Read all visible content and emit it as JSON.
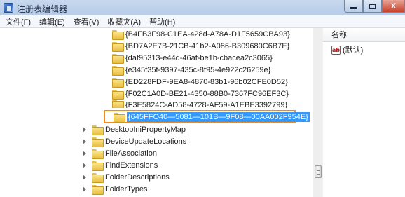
{
  "window": {
    "title": "注册表编辑器",
    "close_glyph": "X",
    "colors": {
      "titlebar": "#b7cce8",
      "selection": "#3399ff",
      "rename_border": "#f08a1c"
    }
  },
  "menu": [
    "文件(F)",
    "编辑(E)",
    "查看(V)",
    "收藏夹(A)",
    "帮助(H)"
  ],
  "tree": {
    "guid_keys": [
      "{B4FB3F98-C1EA-428d-A78A-D1F5659CBA93}",
      "{BD7A2E7B-21CB-41b2-A086-B309680C6B7E}",
      "{daf95313-e44d-46af-be1b-cbacea2c3065}",
      "{e345f35f-9397-435c-8f95-4e922c26259e}",
      "{ED228FDF-9EA8-4870-83b1-96b02CFE0D52}",
      "{F02C1A0D-BE21-4350-88B0-7367FC96EF3C}",
      "{F3E5824C-AD58-4728-AF59-A1EBE3392799}"
    ],
    "rename_value": "{645FFO40—5081—101B—9F08—00AA002F954E}",
    "subkeys": [
      "DesktopIniPropertyMap",
      "DeviceUpdateLocations",
      "FileAssociation",
      "FindExtensions",
      "FolderDescriptions",
      "FolderTypes"
    ]
  },
  "values": {
    "header_name": "名称",
    "items": [
      {
        "icon": "ab-string-icon",
        "icon_text": "ab",
        "name": "(默认)"
      }
    ]
  }
}
